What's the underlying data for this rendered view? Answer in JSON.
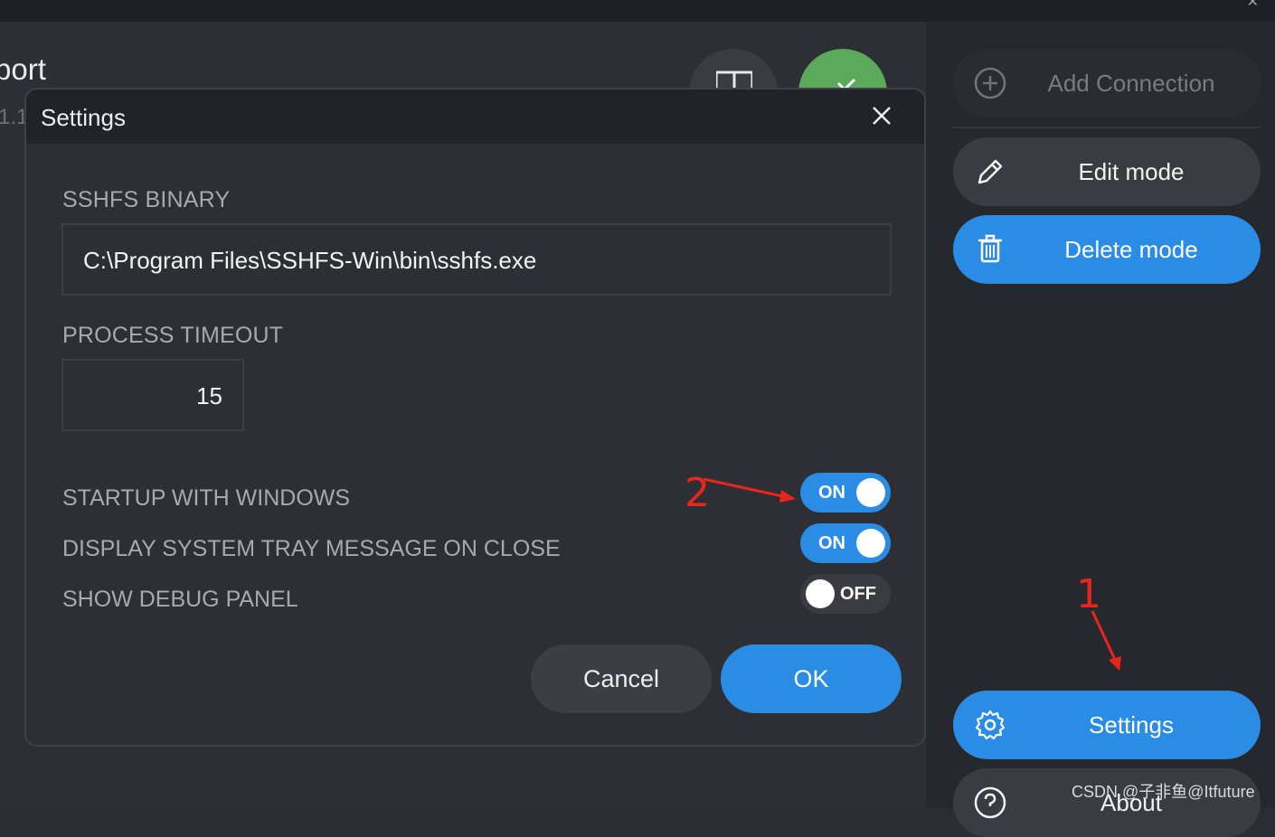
{
  "app": {
    "title_fragment": "port",
    "version_fragment": "1.1"
  },
  "sidebar": {
    "add_connection": "Add Connection",
    "edit_mode": "Edit mode",
    "delete_mode": "Delete mode",
    "settings": "Settings",
    "about": "About"
  },
  "dialog": {
    "title": "Settings",
    "sshfs_binary_label": "SSHFS BINARY",
    "sshfs_binary_value": "C:\\Program Files\\SSHFS-Win\\bin\\sshfs.exe",
    "process_timeout_label": "PROCESS TIMEOUT",
    "process_timeout_value": "15",
    "toggles": [
      {
        "label": "STARTUP WITH WINDOWS",
        "state": "ON"
      },
      {
        "label": "DISPLAY SYSTEM TRAY MESSAGE ON CLOSE",
        "state": "ON"
      },
      {
        "label": "SHOW DEBUG PANEL",
        "state": "OFF"
      }
    ],
    "cancel": "Cancel",
    "ok": "OK"
  },
  "annotations": {
    "marker_1": "1",
    "marker_2": "2"
  },
  "watermark": "CSDN @子非鱼@Itfuture",
  "colors": {
    "accent": "#2b8ce6",
    "background": "#2d2f35",
    "annotation": "#e8251e",
    "green": "#5ba95b"
  }
}
